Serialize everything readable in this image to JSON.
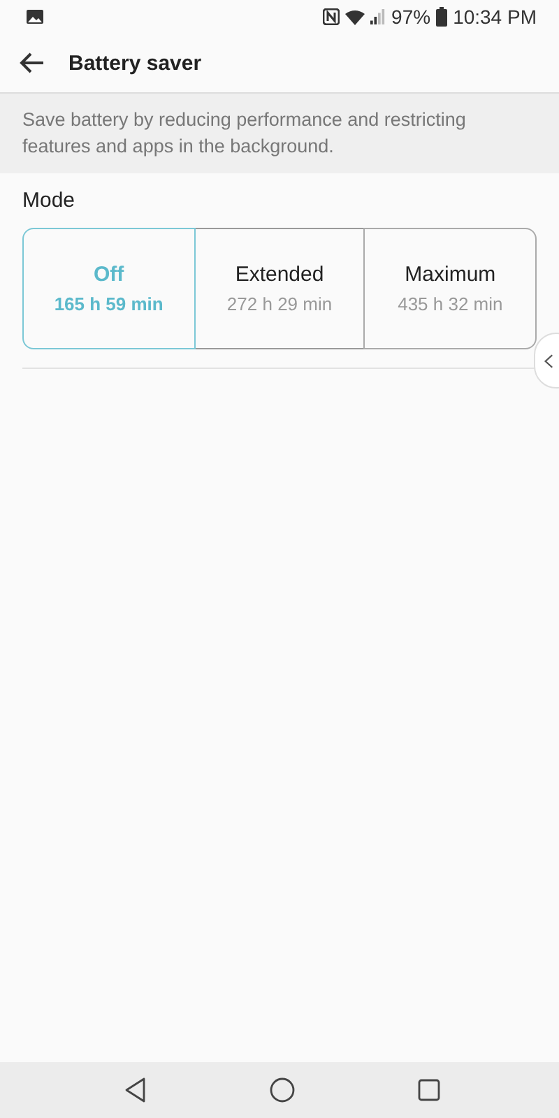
{
  "status_bar": {
    "battery": "97%",
    "time": "10:34 PM"
  },
  "toolbar": {
    "title": "Battery saver"
  },
  "description": "Save battery by reducing performance and restricting features and apps in the background.",
  "mode": {
    "label": "Mode",
    "options": [
      {
        "name": "Off",
        "duration": "165 h 59 min",
        "selected": true
      },
      {
        "name": "Extended",
        "duration": "272 h 29 min",
        "selected": false
      },
      {
        "name": "Maximum",
        "duration": "435 h 32 min",
        "selected": false
      }
    ]
  }
}
